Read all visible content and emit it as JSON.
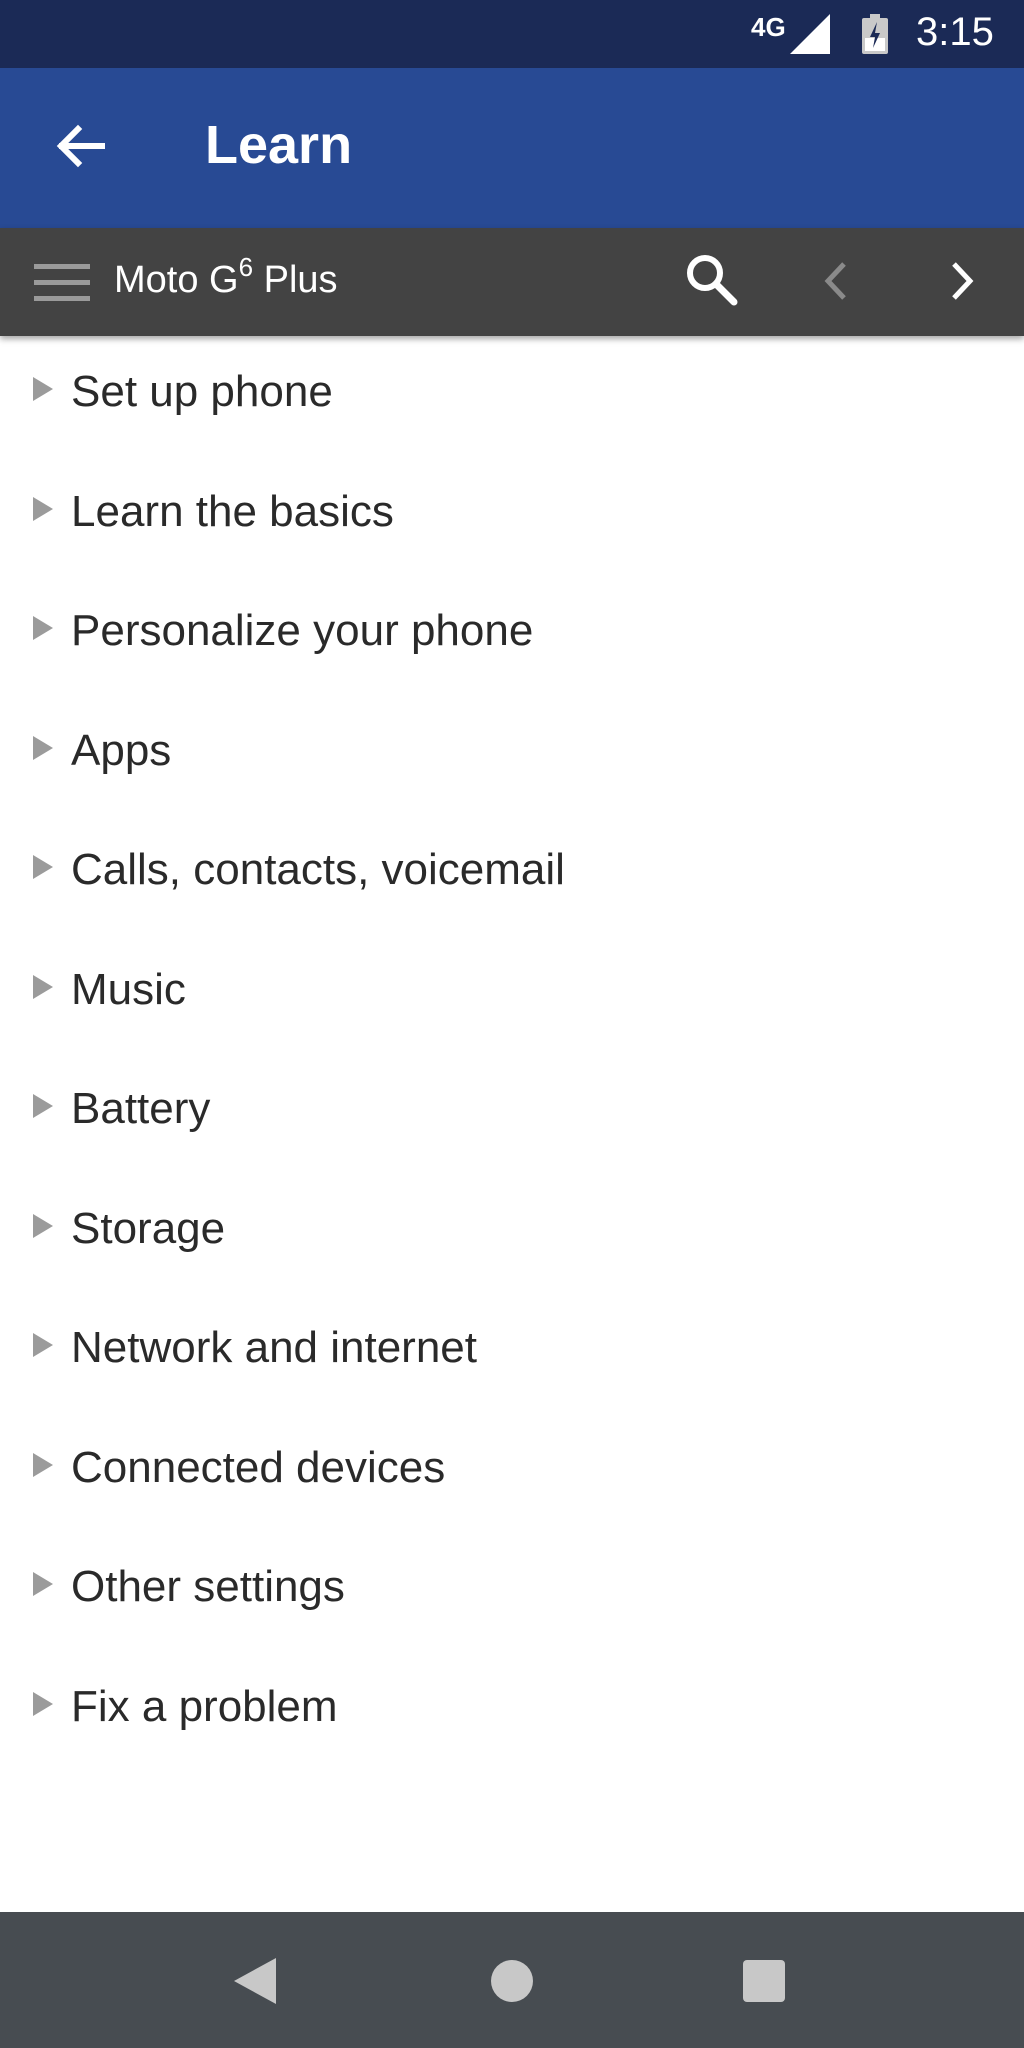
{
  "status_bar": {
    "network": "4G",
    "time": "3:15"
  },
  "app_bar": {
    "title": "Learn"
  },
  "toolbar": {
    "device_name": "Moto G",
    "device_superscript": "6",
    "device_suffix": " Plus"
  },
  "topics": [
    {
      "label": "Set up phone"
    },
    {
      "label": "Learn the basics"
    },
    {
      "label": "Personalize your phone"
    },
    {
      "label": "Apps"
    },
    {
      "label": "Calls, contacts, voicemail"
    },
    {
      "label": "Music"
    },
    {
      "label": "Battery"
    },
    {
      "label": "Storage"
    },
    {
      "label": "Network and internet"
    },
    {
      "label": "Connected devices"
    },
    {
      "label": "Other settings"
    },
    {
      "label": "Fix a problem"
    }
  ],
  "colors": {
    "status_bar": "#1b2a56",
    "app_bar": "#284a94",
    "toolbar": "#434343",
    "nav_bar": "#474c51"
  }
}
